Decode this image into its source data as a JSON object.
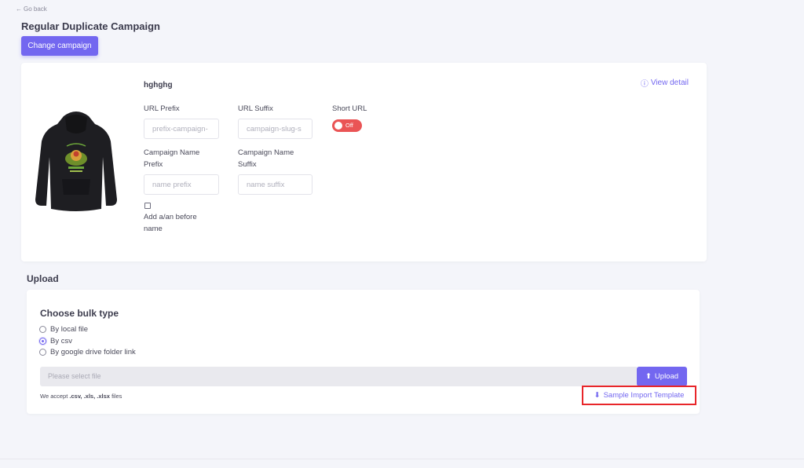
{
  "nav": {
    "go_back": "Go back"
  },
  "page": {
    "title": "Regular Duplicate Campaign",
    "change_campaign": "Change campaign"
  },
  "campaign": {
    "name": "hghghg",
    "view_detail": "View detail",
    "url_prefix": {
      "label": "URL Prefix",
      "placeholder": "prefix-campaign-",
      "value": ""
    },
    "url_suffix": {
      "label": "URL Suffix",
      "placeholder": "campaign-slug-s",
      "value": ""
    },
    "short_url": {
      "label": "Short URL",
      "state": "Off"
    },
    "name_prefix": {
      "label": "Campaign Name Prefix",
      "placeholder": "name prefix",
      "value": ""
    },
    "name_suffix": {
      "label": "Campaign Name Suffix",
      "placeholder": "name suffix",
      "value": ""
    },
    "add_article": {
      "label": "Add a/an before name",
      "checked": false
    }
  },
  "upload": {
    "section_title": "Upload",
    "bulk_title": "Choose bulk type",
    "options": [
      {
        "label": "By local file",
        "checked": false
      },
      {
        "label": "By csv",
        "checked": true
      },
      {
        "label": "By google drive folder link",
        "checked": false
      }
    ],
    "file_placeholder": "Please select file",
    "upload_button": "Upload",
    "accept_prefix": "We accept",
    "accept_formats": ".csv, .xls, .xlsx",
    "accept_suffix": "files",
    "sample_template": "Sample Import Template"
  },
  "colors": {
    "primary": "#7367f0",
    "danger": "#ea5455",
    "highlight_border": "#e8262a"
  }
}
